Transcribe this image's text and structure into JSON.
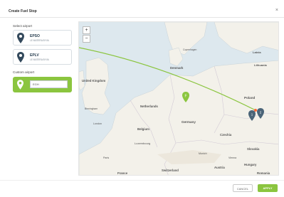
{
  "dialog": {
    "title": "Create Fuel Stop",
    "close_glyph": "×"
  },
  "select_airport": {
    "label": "Select airport",
    "airports": [
      {
        "code": "EPSO",
        "subtitle": "LE MATERA BYVA"
      },
      {
        "code": "EPLV",
        "subtitle": "LE MATERA BYVA"
      }
    ]
  },
  "custom_airport": {
    "label": "Custom airport",
    "value": "EGH"
  },
  "map": {
    "zoom_in": "+",
    "zoom_out": "−",
    "labels": {
      "denmark": "Denmark",
      "united_kingdom": "United Kingdom",
      "netherlands": "Netherlands",
      "belgium": "Belgium",
      "luxembourg": "Luxembourg",
      "germany": "Germany",
      "czechia": "Czechia",
      "poland": "Poland",
      "france": "France",
      "switzerland": "Switzerland",
      "austria": "Austria",
      "slovakia": "Slovakia",
      "hungary": "Hungary",
      "romania": "Romania",
      "lithuania": "Lithuania",
      "latvia": "Latvia",
      "birmingham": "Birmingham",
      "london": "London",
      "paris": "Paris",
      "munich": "Munich",
      "vienna": "Vienna",
      "copenhagen": "Copenhagen"
    },
    "pin_letter": "F",
    "route_color": "#8bc53f",
    "marker_color": "#4a6478"
  },
  "footer": {
    "cancel_label": "CANCEL",
    "apply_label": "APPLY"
  },
  "colors": {
    "accent": "#8bc53f",
    "pin_dark": "#33495c"
  }
}
